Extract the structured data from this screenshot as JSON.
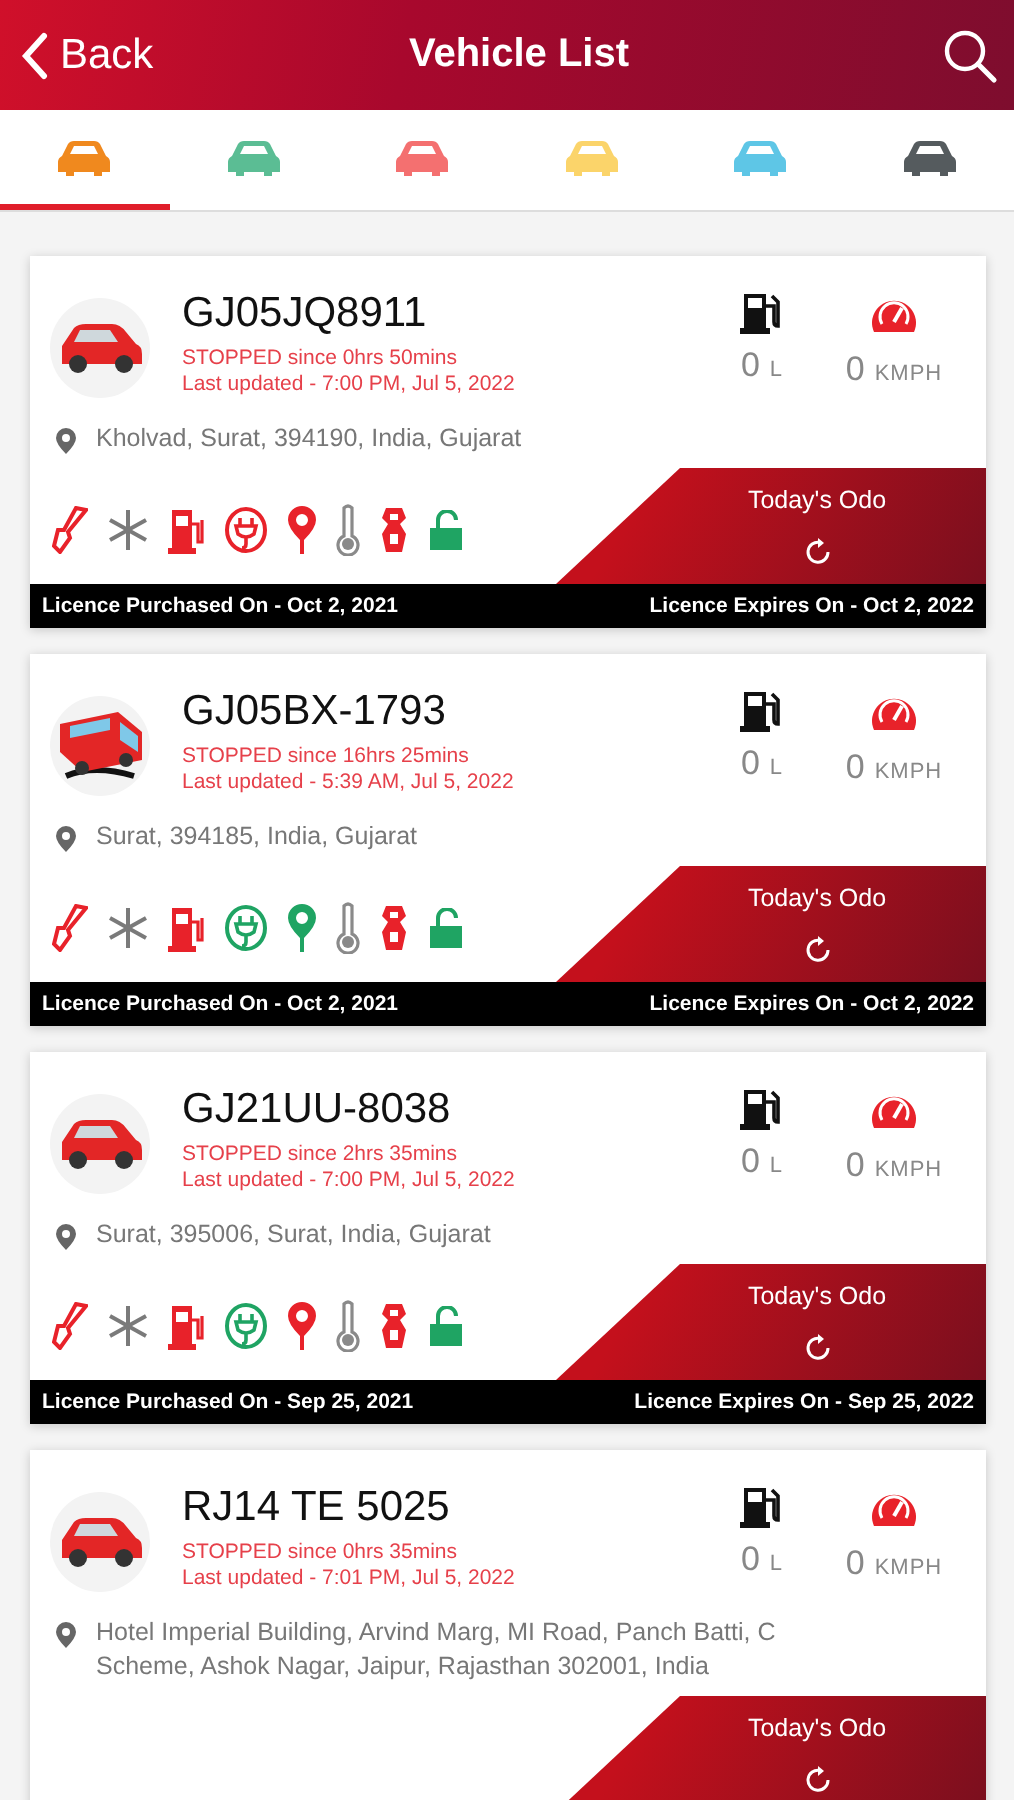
{
  "header": {
    "back_label": "Back",
    "title": "Vehicle List"
  },
  "tabs": [
    {
      "color": "#f0891e",
      "selected": true
    },
    {
      "color": "#5bbd94",
      "selected": false
    },
    {
      "color": "#f47070",
      "selected": false
    },
    {
      "color": "#fbd46a",
      "selected": false
    },
    {
      "color": "#5ec6e6",
      "selected": false
    },
    {
      "color": "#555b5e",
      "selected": false
    }
  ],
  "vehicles": [
    {
      "kind": "car",
      "plate": "GJ05JQ8911",
      "status": "STOPPED since 0hrs 50mins",
      "updated": "Last updated - 7:00 PM, Jul 5, 2022",
      "fuel_value": "0",
      "fuel_unit": "L",
      "speed_value": "0",
      "speed_unit": "KMPH",
      "address": "Kholvad, Surat, 394190, India, Gujarat",
      "sensors": [
        {
          "kind": "key",
          "color": "#e8222a"
        },
        {
          "kind": "snow",
          "color": "#7a7a7a"
        },
        {
          "kind": "fuel",
          "color": "#e8222a"
        },
        {
          "kind": "plug",
          "color": "#e8222a"
        },
        {
          "kind": "pin",
          "color": "#e8222a"
        },
        {
          "kind": "thermo",
          "color": "#8a8a8a"
        },
        {
          "kind": "seat",
          "color": "#e8222a"
        },
        {
          "kind": "lock",
          "color": "#1fa463"
        }
      ],
      "odo_label": "Today's Odo",
      "purchased": "Licence Purchased On - Oct 2, 2021",
      "expires": "Licence Expires On - Oct 2, 2022"
    },
    {
      "kind": "bus",
      "plate": "GJ05BX-1793",
      "status": "STOPPED since 16hrs 25mins",
      "updated": "Last updated - 5:39 AM, Jul 5, 2022",
      "fuel_value": "0",
      "fuel_unit": "L",
      "speed_value": "0",
      "speed_unit": "KMPH",
      "address": "Surat, 394185, India, Gujarat",
      "sensors": [
        {
          "kind": "key",
          "color": "#e8222a"
        },
        {
          "kind": "snow",
          "color": "#7a7a7a"
        },
        {
          "kind": "fuel",
          "color": "#e8222a"
        },
        {
          "kind": "plug",
          "color": "#1fa463"
        },
        {
          "kind": "pin",
          "color": "#1fa463"
        },
        {
          "kind": "thermo",
          "color": "#8a8a8a"
        },
        {
          "kind": "seat",
          "color": "#e8222a"
        },
        {
          "kind": "lock",
          "color": "#1fa463"
        }
      ],
      "odo_label": "Today's Odo",
      "purchased": "Licence Purchased On - Oct 2, 2021",
      "expires": "Licence Expires On - Oct 2, 2022"
    },
    {
      "kind": "car",
      "plate": "GJ21UU-8038",
      "status": "STOPPED since 2hrs 35mins",
      "updated": "Last updated - 7:00 PM, Jul 5, 2022",
      "fuel_value": "0",
      "fuel_unit": "L",
      "speed_value": "0",
      "speed_unit": "KMPH",
      "address": "Surat, 395006, Surat, India, Gujarat",
      "sensors": [
        {
          "kind": "key",
          "color": "#e8222a"
        },
        {
          "kind": "snow",
          "color": "#7a7a7a"
        },
        {
          "kind": "fuel",
          "color": "#e8222a"
        },
        {
          "kind": "plug",
          "color": "#1fa463"
        },
        {
          "kind": "pin",
          "color": "#e8222a"
        },
        {
          "kind": "thermo",
          "color": "#8a8a8a"
        },
        {
          "kind": "seat",
          "color": "#e8222a"
        },
        {
          "kind": "lock",
          "color": "#1fa463"
        }
      ],
      "odo_label": "Today's Odo",
      "purchased": "Licence Purchased On - Sep 25, 2021",
      "expires": "Licence Expires On - Sep 25, 2022"
    },
    {
      "kind": "car",
      "plate": "RJ14 TE 5025",
      "status": "STOPPED since 0hrs 35mins",
      "updated": "Last updated - 7:01 PM, Jul 5, 2022",
      "fuel_value": "0",
      "fuel_unit": "L",
      "speed_value": "0",
      "speed_unit": "KMPH",
      "address": "Hotel Imperial Building, Arvind Marg, MI Road, Panch Batti, C Scheme, Ashok Nagar, Jaipur, Rajasthan 302001, India",
      "odo_label": "Today's Odo"
    }
  ]
}
